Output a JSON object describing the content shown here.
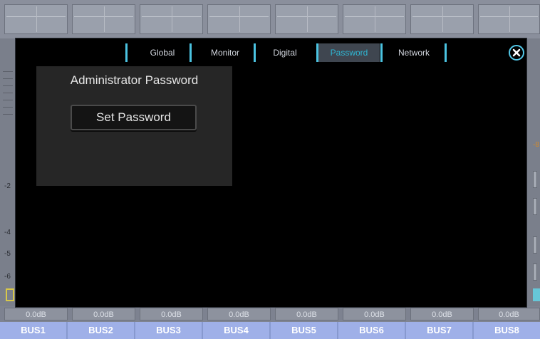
{
  "background": {
    "scale_labels": [
      "-2",
      "-4",
      "-5",
      "-6"
    ],
    "right_label": "-8",
    "gain_labels": [
      "0.0dB",
      "0.0dB",
      "0.0dB",
      "0.0dB",
      "0.0dB",
      "0.0dB",
      "0.0dB",
      "0.0dB"
    ],
    "bus_labels": [
      "BUS1",
      "BUS2",
      "BUS3",
      "BUS4",
      "BUS5",
      "BUS6",
      "BUS7",
      "BUS8"
    ]
  },
  "settings": {
    "tabs": [
      {
        "label": "Global"
      },
      {
        "label": "Monitor"
      },
      {
        "label": "Digital"
      },
      {
        "label": "Password",
        "active": true
      },
      {
        "label": "Network"
      }
    ],
    "close_icon": "close-circle-icon",
    "admin_password": {
      "title": "Administrator Password",
      "set_button_label": "Set Password"
    }
  },
  "colors": {
    "accent": "#4bc3e1",
    "active_tab_text": "#2fb6d3",
    "bus_bg": "#9fb0e8"
  }
}
